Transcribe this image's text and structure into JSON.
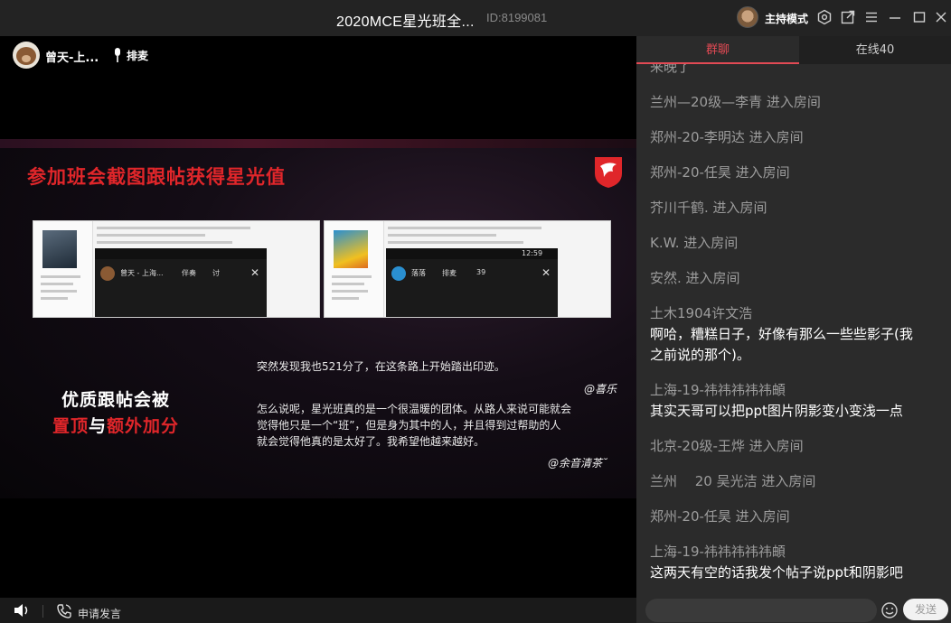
{
  "titlebar": {
    "title": "2020MCE星光班全...",
    "room_id": "ID:8199081",
    "host_mode": "主持模式",
    "icons": [
      "avatar",
      "settings-icon",
      "external-link-icon",
      "menu-icon",
      "minimize-icon",
      "maximize-icon",
      "close-icon"
    ]
  },
  "stage": {
    "speaker_name": "曾天-上...",
    "queue_label": "排麦"
  },
  "slide": {
    "title": "参加班会截图跟帖获得星光值",
    "quote1": "突然发现我也521分了，在这条路上开始踏出印迹。",
    "quote1_by": "@喜乐",
    "quote2_l1": "怎么说呢，星光班真的是一个很温暖的团体。从路人来说可能就会",
    "quote2_l2": "觉得他只是一个“班”，但是身为其中的人，并且得到过帮助的人",
    "quote2_l3": "就会觉得他真的是太好了。我希望他越来越好。",
    "quote2_by": "@余音清茶˘",
    "promo_line1": "优质跟帖会被",
    "promo_red1": "置顶",
    "promo_mid": "与",
    "promo_red2": "额外加分",
    "shot1": {
      "label1": "曾天 - 上海...",
      "label2": "伴奏",
      "label3": "讨"
    },
    "shot2": {
      "time": "12:59",
      "label1": "落落",
      "label2": "排麦",
      "label3": "39"
    },
    "accent_color": "#e0262a"
  },
  "bottombar": {
    "apply_label": "申请发言"
  },
  "panel": {
    "tab_group": "群聊",
    "tab_online": "在线40",
    "messages": [
      {
        "kind": "sys",
        "text": "来晚了"
      },
      {
        "kind": "sys",
        "text": "兰州—20级—李青 进入房间"
      },
      {
        "kind": "sys",
        "text": "郑州-20-李明达 进入房间"
      },
      {
        "kind": "sys",
        "text": "郑州-20-任昊 进入房间"
      },
      {
        "kind": "sys",
        "text": "芥川千鹤. 进入房间"
      },
      {
        "kind": "sys",
        "text": "K.W. 进入房间"
      },
      {
        "kind": "sys",
        "text": "安然. 进入房间"
      },
      {
        "kind": "user",
        "text": "土木1904许文浩"
      },
      {
        "kind": "text",
        "text": "啊哈，糟糕日子，好像有那么一些些影子(我"
      },
      {
        "kind": "text",
        "text": "之前说的那个)。"
      },
      {
        "kind": "user",
        "text": "上海-19-祎祎祎祎祎頔"
      },
      {
        "kind": "text",
        "text": "其实天哥可以把ppt图片阴影变小变浅一点"
      },
      {
        "kind": "sys",
        "text": "北京-20级-王烨 进入房间"
      },
      {
        "kind": "sys",
        "text": "兰州　 20  吴光洁 进入房间"
      },
      {
        "kind": "sys",
        "text": "郑州-20-任昊 进入房间"
      },
      {
        "kind": "user",
        "text": "上海-19-祎祎祎祎祎頔"
      },
      {
        "kind": "text",
        "text": "这两天有空的话我发个帖子说ppt和阴影吧"
      }
    ],
    "send_label": "发送",
    "accent_color": "#e24a54"
  }
}
